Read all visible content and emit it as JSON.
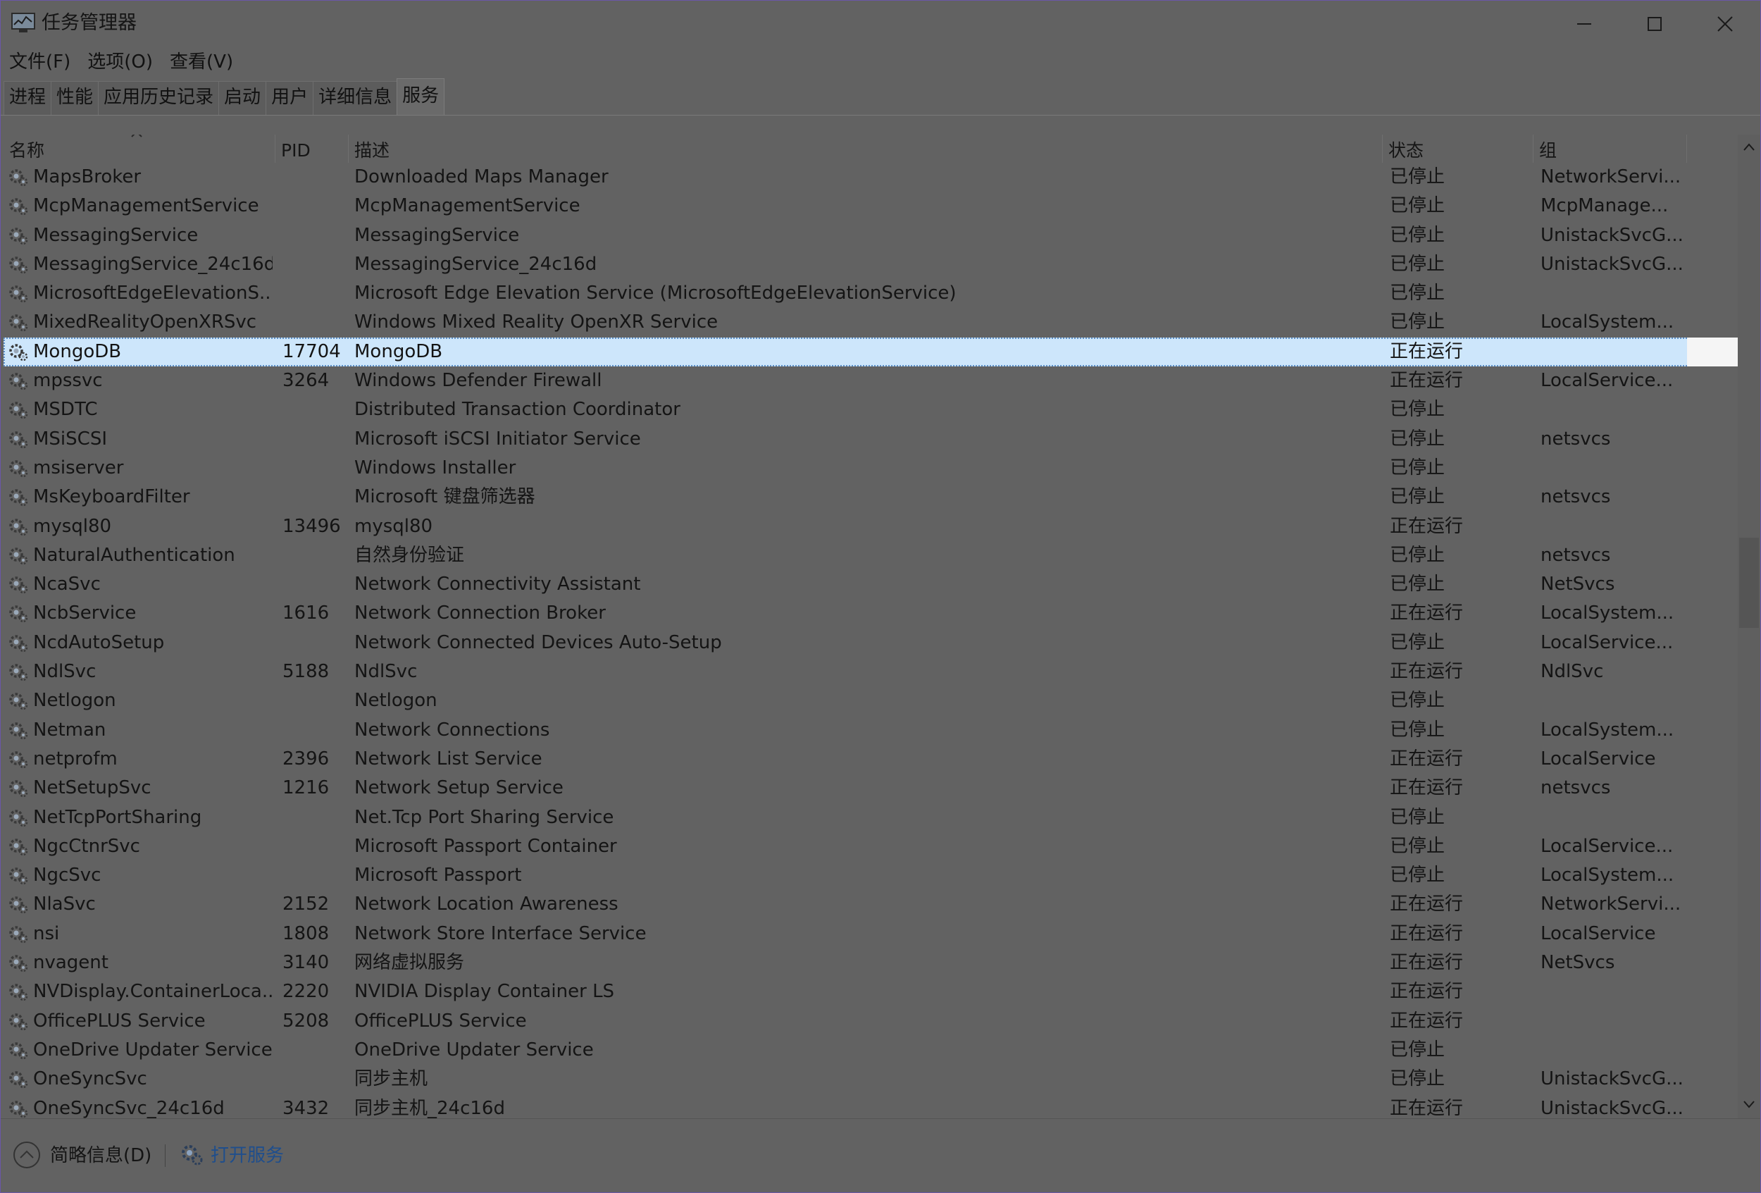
{
  "window": {
    "title": "任务管理器"
  },
  "menu": [
    "文件(F)",
    "选项(O)",
    "查看(V)"
  ],
  "tabs": [
    {
      "label": "进程"
    },
    {
      "label": "性能"
    },
    {
      "label": "应用历史记录"
    },
    {
      "label": "启动"
    },
    {
      "label": "用户"
    },
    {
      "label": "详细信息"
    },
    {
      "label": "服务",
      "active": true
    }
  ],
  "columns": {
    "name": "名称",
    "pid": "PID",
    "desc": "描述",
    "status": "状态",
    "group": "组"
  },
  "rows": [
    {
      "name": "MapsBroker",
      "pid": "",
      "desc": "Downloaded Maps Manager",
      "status": "已停止",
      "group": "NetworkServi..."
    },
    {
      "name": "McpManagementService",
      "pid": "",
      "desc": "McpManagementService",
      "status": "已停止",
      "group": "McpManage..."
    },
    {
      "name": "MessagingService",
      "pid": "",
      "desc": "MessagingService",
      "status": "已停止",
      "group": "UnistackSvcG..."
    },
    {
      "name": "MessagingService_24c16d",
      "pid": "",
      "desc": "MessagingService_24c16d",
      "status": "已停止",
      "group": "UnistackSvcG..."
    },
    {
      "name": "MicrosoftEdgeElevationS...",
      "pid": "",
      "desc": "Microsoft Edge Elevation Service (MicrosoftEdgeElevationService)",
      "status": "已停止",
      "group": ""
    },
    {
      "name": "MixedRealityOpenXRSvc",
      "pid": "",
      "desc": "Windows Mixed Reality OpenXR Service",
      "status": "已停止",
      "group": "LocalSystem..."
    },
    {
      "name": "MongoDB",
      "pid": "17704",
      "desc": "MongoDB",
      "status": "正在运行",
      "group": "",
      "selected": true
    },
    {
      "name": "mpssvc",
      "pid": "3264",
      "desc": "Windows Defender Firewall",
      "status": "正在运行",
      "group": "LocalService..."
    },
    {
      "name": "MSDTC",
      "pid": "",
      "desc": "Distributed Transaction Coordinator",
      "status": "已停止",
      "group": ""
    },
    {
      "name": "MSiSCSI",
      "pid": "",
      "desc": "Microsoft iSCSI Initiator Service",
      "status": "已停止",
      "group": "netsvcs"
    },
    {
      "name": "msiserver",
      "pid": "",
      "desc": "Windows Installer",
      "status": "已停止",
      "group": ""
    },
    {
      "name": "MsKeyboardFilter",
      "pid": "",
      "desc": "Microsoft 键盘筛选器",
      "status": "已停止",
      "group": "netsvcs"
    },
    {
      "name": "mysql80",
      "pid": "13496",
      "desc": "mysql80",
      "status": "正在运行",
      "group": ""
    },
    {
      "name": "NaturalAuthentication",
      "pid": "",
      "desc": "自然身份验证",
      "status": "已停止",
      "group": "netsvcs"
    },
    {
      "name": "NcaSvc",
      "pid": "",
      "desc": "Network Connectivity Assistant",
      "status": "已停止",
      "group": "NetSvcs"
    },
    {
      "name": "NcbService",
      "pid": "1616",
      "desc": "Network Connection Broker",
      "status": "正在运行",
      "group": "LocalSystem..."
    },
    {
      "name": "NcdAutoSetup",
      "pid": "",
      "desc": "Network Connected Devices Auto-Setup",
      "status": "已停止",
      "group": "LocalService..."
    },
    {
      "name": "NdlSvc",
      "pid": "5188",
      "desc": "NdlSvc",
      "status": "正在运行",
      "group": "NdlSvc"
    },
    {
      "name": "Netlogon",
      "pid": "",
      "desc": "Netlogon",
      "status": "已停止",
      "group": ""
    },
    {
      "name": "Netman",
      "pid": "",
      "desc": "Network Connections",
      "status": "已停止",
      "group": "LocalSystem..."
    },
    {
      "name": "netprofm",
      "pid": "2396",
      "desc": "Network List Service",
      "status": "正在运行",
      "group": "LocalService"
    },
    {
      "name": "NetSetupSvc",
      "pid": "1216",
      "desc": "Network Setup Service",
      "status": "正在运行",
      "group": "netsvcs"
    },
    {
      "name": "NetTcpPortSharing",
      "pid": "",
      "desc": "Net.Tcp Port Sharing Service",
      "status": "已停止",
      "group": ""
    },
    {
      "name": "NgcCtnrSvc",
      "pid": "",
      "desc": "Microsoft Passport Container",
      "status": "已停止",
      "group": "LocalService..."
    },
    {
      "name": "NgcSvc",
      "pid": "",
      "desc": "Microsoft Passport",
      "status": "已停止",
      "group": "LocalSystem..."
    },
    {
      "name": "NlaSvc",
      "pid": "2152",
      "desc": "Network Location Awareness",
      "status": "正在运行",
      "group": "NetworkServi..."
    },
    {
      "name": "nsi",
      "pid": "1808",
      "desc": "Network Store Interface Service",
      "status": "正在运行",
      "group": "LocalService"
    },
    {
      "name": "nvagent",
      "pid": "3140",
      "desc": "网络虚拟服务",
      "status": "正在运行",
      "group": "NetSvcs"
    },
    {
      "name": "NVDisplay.ContainerLoca...",
      "pid": "2220",
      "desc": "NVIDIA Display Container LS",
      "status": "正在运行",
      "group": ""
    },
    {
      "name": "OfficePLUS Service",
      "pid": "5208",
      "desc": "OfficePLUS Service",
      "status": "正在运行",
      "group": ""
    },
    {
      "name": "OneDrive Updater Service",
      "pid": "",
      "desc": "OneDrive Updater Service",
      "status": "已停止",
      "group": ""
    },
    {
      "name": "OneSyncSvc",
      "pid": "",
      "desc": "同步主机",
      "status": "已停止",
      "group": "UnistackSvcG..."
    },
    {
      "name": "OneSyncSvc_24c16d",
      "pid": "3432",
      "desc": "同步主机_24c16d",
      "status": "正在运行",
      "group": "UnistackSvcG..."
    }
  ],
  "footer": {
    "summary": "简略信息(D)",
    "open_services": "打开服务"
  },
  "colors": {
    "selection": "#cde6fb",
    "link": "#1f4e8c",
    "background": "#626262"
  },
  "icons": {
    "app": "task-manager-icon",
    "service": "gear-service-icon"
  }
}
